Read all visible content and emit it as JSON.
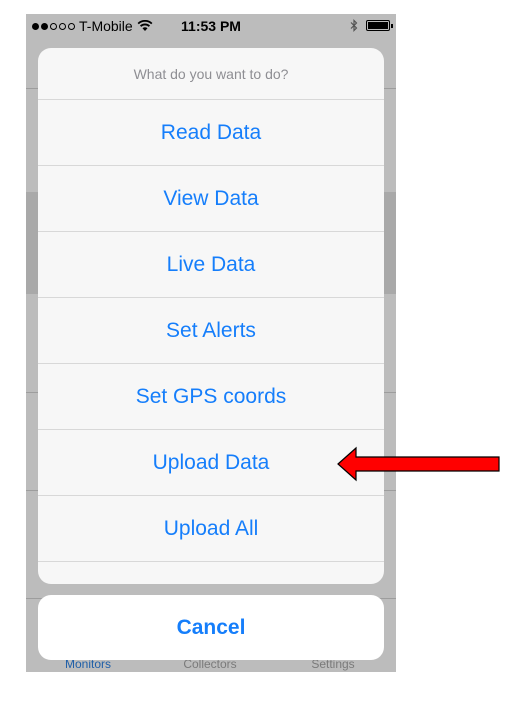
{
  "status_bar": {
    "carrier": "T-Mobile",
    "time": "11:53 PM",
    "signal_filled": 2,
    "signal_total": 5
  },
  "action_sheet": {
    "title": "What do you want to do?",
    "items": [
      {
        "label": "Read Data"
      },
      {
        "label": "View Data"
      },
      {
        "label": "Live Data"
      },
      {
        "label": "Set Alerts"
      },
      {
        "label": "Set GPS coords"
      },
      {
        "label": "Upload Data"
      },
      {
        "label": "Upload All"
      }
    ],
    "cancel_label": "Cancel"
  },
  "tab_bar": {
    "tabs": [
      {
        "label": "Monitors",
        "active": true
      },
      {
        "label": "Collectors",
        "active": false
      },
      {
        "label": "Settings",
        "active": false
      }
    ]
  },
  "annotation": {
    "arrow_color": "#ff0000",
    "points_to": "Upload Data"
  },
  "colors": {
    "accent": "#157efb",
    "dim_background": "#bcbcbc"
  }
}
